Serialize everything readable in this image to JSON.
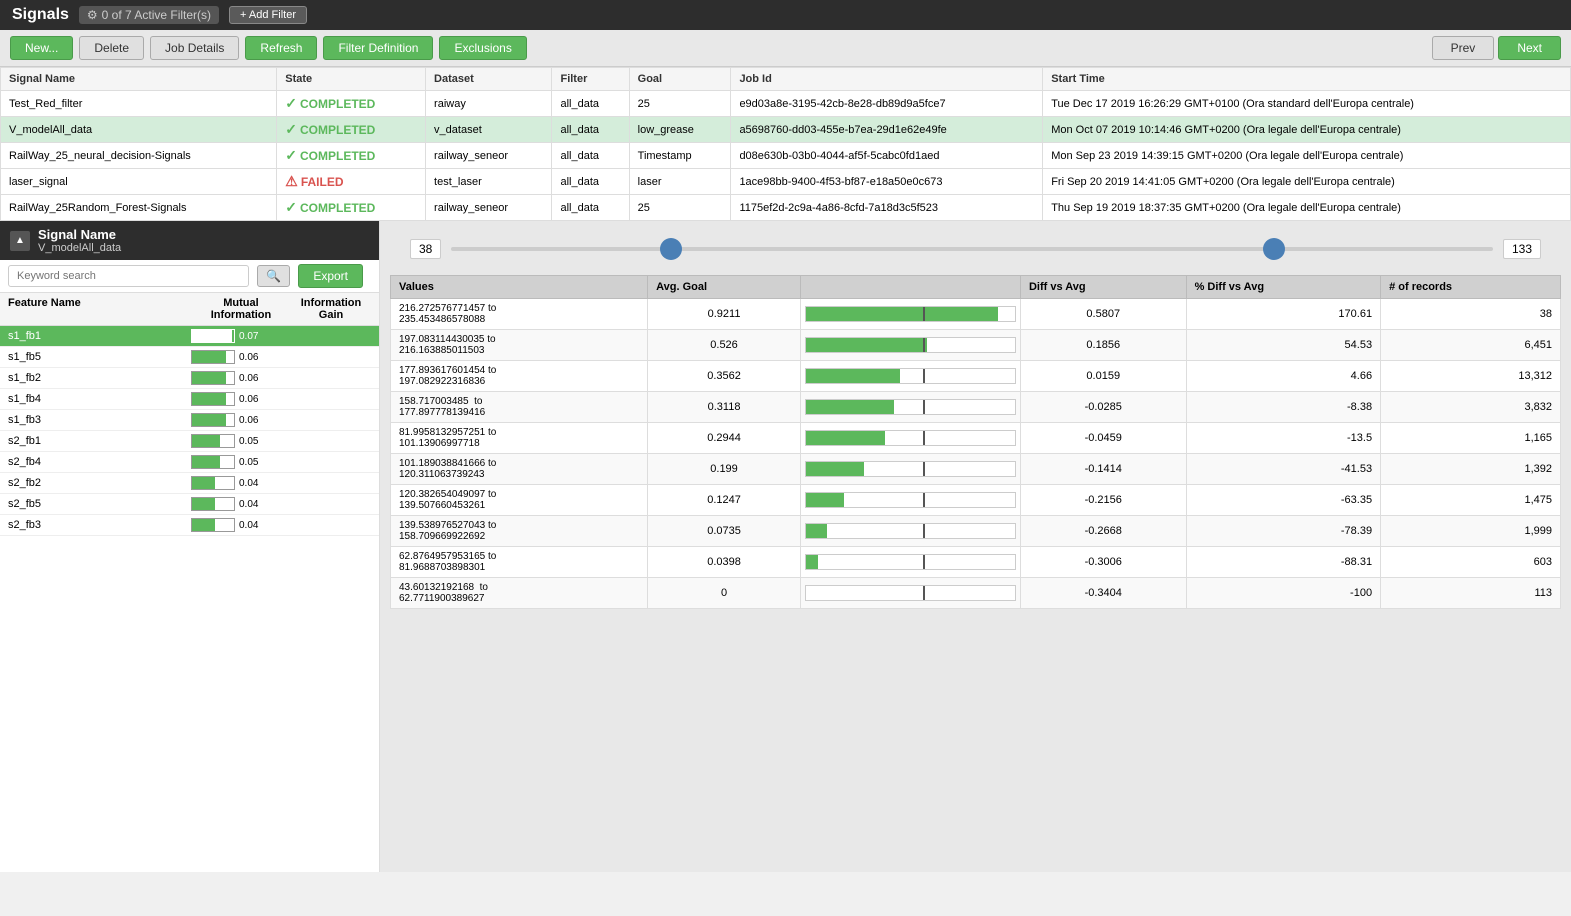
{
  "app": {
    "title": "Signals",
    "filter_badge": "0 of 7 Active Filter(s)",
    "add_filter": "+ Add Filter"
  },
  "toolbar": {
    "new_label": "New...",
    "delete_label": "Delete",
    "job_details_label": "Job Details",
    "refresh_label": "Refresh",
    "filter_def_label": "Filter Definition",
    "exclusions_label": "Exclusions",
    "prev_label": "Prev",
    "next_label": "Next"
  },
  "table": {
    "headers": [
      "Signal Name",
      "State",
      "Dataset",
      "Filter",
      "Goal",
      "Job Id",
      "Start Time"
    ],
    "rows": [
      {
        "name": "Test_Red_filter",
        "state": "COMPLETED",
        "state_ok": true,
        "dataset": "raiway",
        "filter": "all_data",
        "goal": "25",
        "job_id": "e9d03a8e-3195-42cb-8e28-db89d9a5fce7",
        "start_time": "Tue Dec 17 2019 16:26:29 GMT+0100 (Ora standard dell'Europa centrale)",
        "selected": false
      },
      {
        "name": "V_modelAll_data",
        "state": "COMPLETED",
        "state_ok": true,
        "dataset": "v_dataset",
        "filter": "all_data",
        "goal": "low_grease",
        "job_id": "a5698760-dd03-455e-b7ea-29d1e62e49fe",
        "start_time": "Mon Oct 07 2019 10:14:46 GMT+0200 (Ora legale dell'Europa centrale)",
        "selected": true
      },
      {
        "name": "RailWay_25_neural_decision-Signals",
        "state": "COMPLETED",
        "state_ok": true,
        "dataset": "railway_seneor",
        "filter": "all_data",
        "goal": "Timestamp",
        "job_id": "d08e630b-03b0-4044-af5f-5cabc0fd1aed",
        "start_time": "Mon Sep 23 2019 14:39:15 GMT+0200 (Ora legale dell'Europa centrale)",
        "selected": false
      },
      {
        "name": "laser_signal",
        "state": "FAILED",
        "state_ok": false,
        "dataset": "test_laser",
        "filter": "all_data",
        "goal": "laser",
        "job_id": "1ace98bb-9400-4f53-bf87-e18a50e0c673",
        "start_time": "Fri Sep 20 2019 14:41:05 GMT+0200 (Ora legale dell'Europa centrale)",
        "selected": false
      },
      {
        "name": "RailWay_25Random_Forest-Signals",
        "state": "COMPLETED",
        "state_ok": true,
        "dataset": "railway_seneor",
        "filter": "all_data",
        "goal": "25",
        "job_id": "1175ef2d-2c9a-4a86-8cfd-7a18d3c5f523",
        "start_time": "Thu Sep 19 2019 18:37:35 GMT+0200 (Ora legale dell'Europa centrale)",
        "selected": false
      }
    ]
  },
  "left_panel": {
    "signal_name_label": "Signal Name",
    "signal_name_value": "V_modelAll_data",
    "search_placeholder": "Keyword search",
    "export_label": "Export",
    "feature_col_label": "Feature Name",
    "mi_col_label": "Mutual Information",
    "ig_col_label": "Information Gain",
    "features": [
      {
        "name": "s1_fb1",
        "mi": 0.07,
        "mi_pct": 100,
        "ig": "",
        "active": true
      },
      {
        "name": "s1_fb5",
        "mi": 0.06,
        "mi_pct": 85,
        "ig": "",
        "active": false
      },
      {
        "name": "s1_fb2",
        "mi": 0.06,
        "mi_pct": 85,
        "ig": "",
        "active": false
      },
      {
        "name": "s1_fb4",
        "mi": 0.06,
        "mi_pct": 85,
        "ig": "",
        "active": false
      },
      {
        "name": "s1_fb3",
        "mi": 0.06,
        "mi_pct": 85,
        "ig": "",
        "active": false
      },
      {
        "name": "s2_fb1",
        "mi": 0.05,
        "mi_pct": 71,
        "ig": "",
        "active": false
      },
      {
        "name": "s2_fb4",
        "mi": 0.05,
        "mi_pct": 71,
        "ig": "",
        "active": false
      },
      {
        "name": "s2_fb2",
        "mi": 0.04,
        "mi_pct": 57,
        "ig": "",
        "active": false
      },
      {
        "name": "s2_fb5",
        "mi": 0.04,
        "mi_pct": 57,
        "ig": "",
        "active": false
      },
      {
        "name": "s2_fb3",
        "mi": 0.04,
        "mi_pct": 57,
        "ig": "",
        "active": false
      }
    ]
  },
  "right_panel": {
    "slider_left": "38",
    "slider_right": "133",
    "col_values": "Values",
    "col_avg_goal": "Avg. Goal",
    "col_diff_vs_avg": "Diff vs Avg",
    "col_pct_diff": "% Diff vs Avg",
    "col_records": "# of records",
    "rows": [
      {
        "range": "216.272576771457 to\n235.453486578088",
        "avg_goal": "0.9211",
        "bar_pct": 92,
        "diff": "0.5807",
        "pct_diff": "170.61",
        "records": "38"
      },
      {
        "range": "197.083114430035 to\n216.163885011503",
        "avg_goal": "0.526",
        "bar_pct": 58,
        "diff": "0.1856",
        "pct_diff": "54.53",
        "records": "6,451"
      },
      {
        "range": "177.893617601454 to\n197.082922316836",
        "avg_goal": "0.3562",
        "bar_pct": 45,
        "diff": "0.0159",
        "pct_diff": "4.66",
        "records": "13,312"
      },
      {
        "range": "158.717003485  to\n177.897778139416",
        "avg_goal": "0.3118",
        "bar_pct": 42,
        "diff": "-0.0285",
        "pct_diff": "-8.38",
        "records": "3,832"
      },
      {
        "range": "81.9958132957251 to\n101.13906997718",
        "avg_goal": "0.2944",
        "bar_pct": 38,
        "diff": "-0.0459",
        "pct_diff": "-13.5",
        "records": "1,165"
      },
      {
        "range": "101.189038841666 to\n120.311063739243",
        "avg_goal": "0.199",
        "bar_pct": 28,
        "diff": "-0.1414",
        "pct_diff": "-41.53",
        "records": "1,392"
      },
      {
        "range": "120.382654049097 to\n139.507660453261",
        "avg_goal": "0.1247",
        "bar_pct": 18,
        "diff": "-0.2156",
        "pct_diff": "-63.35",
        "records": "1,475"
      },
      {
        "range": "139.538976527043 to\n158.709669922692",
        "avg_goal": "0.0735",
        "bar_pct": 10,
        "diff": "-0.2668",
        "pct_diff": "-78.39",
        "records": "1,999"
      },
      {
        "range": "62.8764957953165 to\n81.9688703898301",
        "avg_goal": "0.0398",
        "bar_pct": 6,
        "diff": "-0.3006",
        "pct_diff": "-88.31",
        "records": "603"
      },
      {
        "range": "43.60132192168  to\n62.7711900389627",
        "avg_goal": "0",
        "bar_pct": 0,
        "diff": "-0.3404",
        "pct_diff": "-100",
        "records": "113"
      }
    ]
  }
}
